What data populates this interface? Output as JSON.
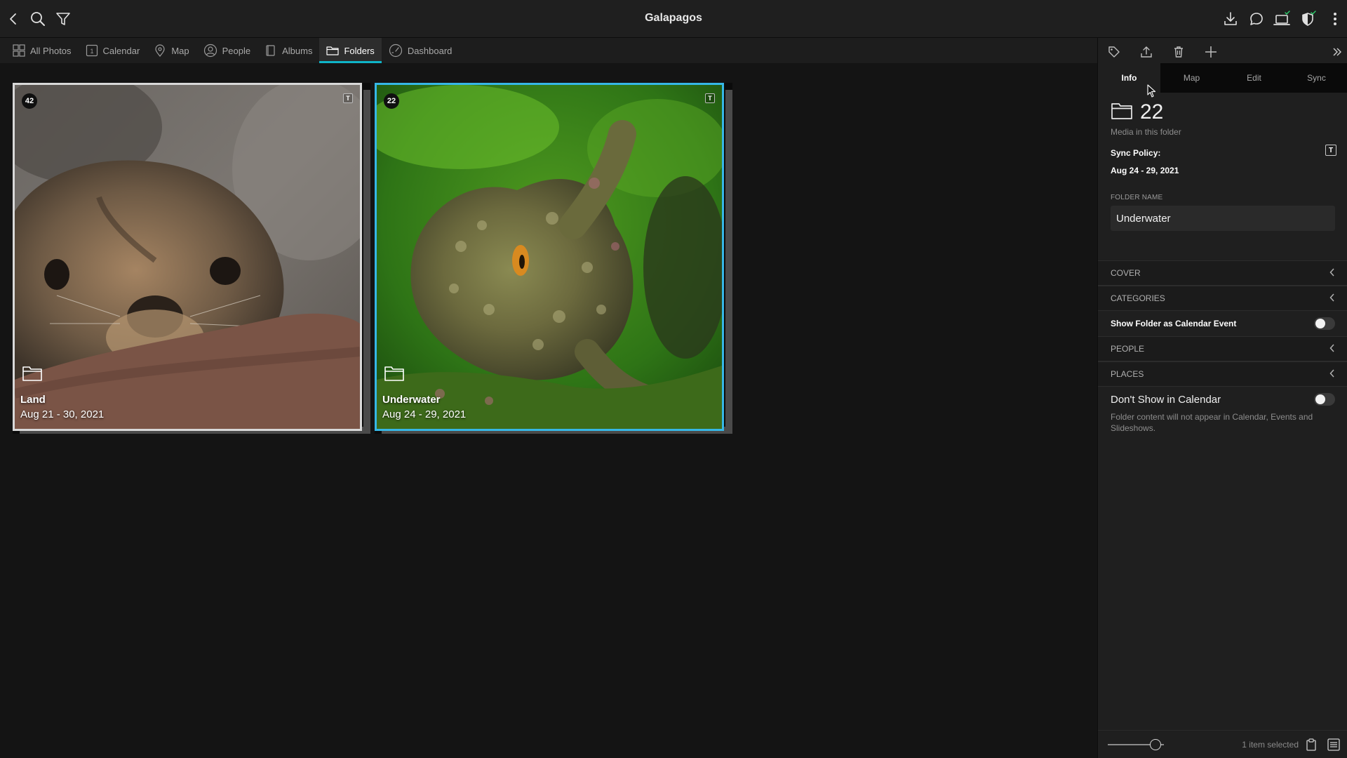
{
  "app": {
    "title": "Galapagos"
  },
  "titlebar": {
    "left_icons": [
      "back-icon",
      "search-icon",
      "filter-icon"
    ],
    "right_icons": [
      "import-icon",
      "chat-icon",
      "laptop-sync-icon",
      "shield-icon",
      "more-icon"
    ],
    "check_color": "#2dd36f"
  },
  "nav": {
    "items": [
      {
        "label": "All Photos",
        "icon": "grid-icon",
        "active": false
      },
      {
        "label": "Calendar",
        "icon": "calendar-icon",
        "active": false
      },
      {
        "label": "Map",
        "icon": "map-pin-icon",
        "active": false
      },
      {
        "label": "People",
        "icon": "person-icon",
        "active": false
      },
      {
        "label": "Albums",
        "icon": "albums-icon",
        "active": false
      },
      {
        "label": "Folders",
        "icon": "folder-icon",
        "active": true
      },
      {
        "label": "Dashboard",
        "icon": "dashboard-icon",
        "active": false
      }
    ],
    "accent": "#0fb4c8"
  },
  "folders": [
    {
      "count": "42",
      "name": "Land",
      "dates": "Aug 21 - 30, 2021",
      "badge": "T",
      "selected": false,
      "image": "sea-lion-photo"
    },
    {
      "count": "22",
      "name": "Underwater",
      "dates": "Aug 24 - 29, 2021",
      "badge": "T",
      "selected": true,
      "image": "octopus-photo"
    }
  ],
  "inspector": {
    "toolbar_icons": [
      "tag-icon",
      "share-icon",
      "trash-icon",
      "plus-icon",
      "expand-icon"
    ],
    "tabs": [
      {
        "label": "Info",
        "active": true
      },
      {
        "label": "Map",
        "active": false
      },
      {
        "label": "Edit",
        "active": false
      },
      {
        "label": "Sync",
        "active": false
      }
    ],
    "media_count": "22",
    "media_label": "Media in this folder",
    "sync_policy_label": "Sync Policy:",
    "sync_badge": "T",
    "date_range": "Aug 24 - 29, 2021",
    "folder_name_label": "FOLDER NAME",
    "folder_name_value": "Underwater",
    "sections": {
      "cover": "COVER",
      "categories": "CATEGORIES",
      "people": "PEOPLE",
      "places": "PLACES"
    },
    "show_as_calendar_event": {
      "label": "Show Folder as Calendar Event",
      "on": false
    },
    "dont_show_in_calendar": {
      "label": "Don't Show in Calendar",
      "on": false,
      "description": "Folder content will not appear in Calendar, Events and Slideshows."
    },
    "footer": {
      "selected_text": "1 item selected",
      "zoom_level": 0.85
    }
  }
}
